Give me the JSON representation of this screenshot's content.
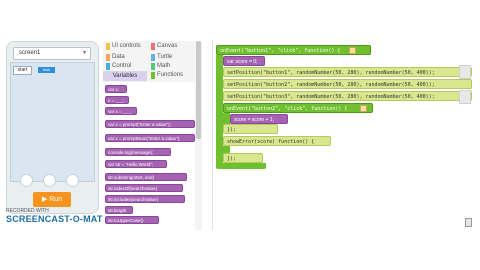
{
  "app_preview": {
    "screen_selector": "screen1",
    "start_button": "start",
    "blue_button": "blue",
    "run_button": "Run"
  },
  "categories": {
    "ui_controls": "UI controls",
    "data": "Data",
    "control": "Control",
    "variables": "Variables",
    "canvas": "Canvas",
    "turtle": "Turtle",
    "math": "Math",
    "functions": "Functions"
  },
  "palette": {
    "items": [
      "var x;",
      "x = ___;",
      "var x = ___;",
      "var x = prompt(\"Enter a value\");",
      "var x = promptNum(\"Enter a value\");",
      "console.log(message);",
      "var str = \"Hello World\";",
      "str.substring(start, end)",
      "str.indexOf(searchValue)",
      "str.includes(searchValue)",
      "str.length",
      "str.toUpperCase()",
      "str.toLowerCase()"
    ]
  },
  "workspace": {
    "code_lines": {
      "line1": "onEvent(\"button1\", \"click\", function() {",
      "line2": "var score = 0;",
      "line3": "setPosition(\"button1\", randomNumber(50, 280), randomNumber(50, 400));",
      "line4": "setPosition(\"button2\", randomNumber(50, 280), randomNumber(50, 400));",
      "line5": "setPosition(\"button3\", randomNumber(50, 280), randomNumber(50, 400));",
      "line6": "onEvent(\"button2\", \"click\", function() {",
      "line7": "score = score + 1;",
      "line8": "});",
      "line9": "showError(score) function() {",
      "line10": "});"
    }
  },
  "watermark": {
    "top": "RECORDED WITH",
    "main": "SCREENCAST-O-MATIC"
  }
}
